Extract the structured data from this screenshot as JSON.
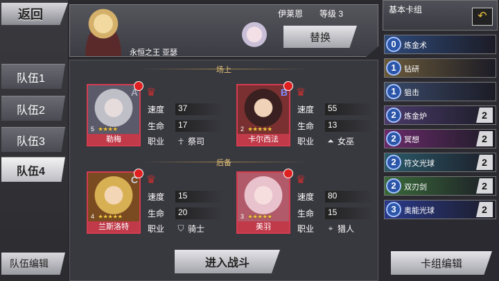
{
  "nav": {
    "back_label": "返回",
    "team_edit_label": "队伍编辑"
  },
  "teams": [
    {
      "label": "队伍1",
      "active": false
    },
    {
      "label": "队伍2",
      "active": false
    },
    {
      "label": "队伍3",
      "active": false
    },
    {
      "label": "队伍4",
      "active": true
    }
  ],
  "header": {
    "leader_name": "永恒之王 亚瑟",
    "user_name": "伊莱恩",
    "level_label": "等级 3",
    "replace_label": "替换"
  },
  "sections": {
    "field_label": "场上",
    "reserve_label": "后备"
  },
  "stat_labels": {
    "speed": "速度",
    "hp": "生命",
    "job": "职业"
  },
  "field": [
    {
      "name": "勒梅",
      "number": "5",
      "grade": "A",
      "speed": "37",
      "hp": "17",
      "job": "祭司",
      "job_icon": "ankh-icon",
      "stars": "★★★★",
      "art": "#cfcfd6"
    },
    {
      "name": "卡尔西法",
      "number": "2",
      "grade": "B",
      "speed": "55",
      "hp": "13",
      "job": "女巫",
      "job_icon": "witch-hat-icon",
      "stars": "★★★★★",
      "art": "#4a2e2e"
    }
  ],
  "reserve": [
    {
      "name": "兰斯洛特",
      "number": "4",
      "grade": "C",
      "speed": "15",
      "hp": "20",
      "job": "骑士",
      "job_icon": "shield-icon",
      "stars": "★★★★★",
      "art": "#d9b25a"
    },
    {
      "name": "美羽",
      "number": "3",
      "grade": "",
      "speed": "80",
      "hp": "15",
      "job": "猎人",
      "job_icon": "crosshair-icon",
      "stars": "★★★★★",
      "art": "#f0c8cc"
    }
  ],
  "enter_battle_label": "进入战斗",
  "deck": {
    "title": "基本卡组",
    "undo_icon": "return-arrow-icon",
    "edit_label": "卡组编辑",
    "cards": [
      {
        "cost": "0",
        "name": "炼金术",
        "count": ""
      },
      {
        "cost": "1",
        "name": "钻研",
        "count": ""
      },
      {
        "cost": "1",
        "name": "狙击",
        "count": ""
      },
      {
        "cost": "2",
        "name": "炼金炉",
        "count": "2"
      },
      {
        "cost": "2",
        "name": "冥想",
        "count": "2"
      },
      {
        "cost": "2",
        "name": "符文光球",
        "count": "2"
      },
      {
        "cost": "2",
        "name": "双刃剑",
        "count": "2"
      },
      {
        "cost": "3",
        "name": "奥能光球",
        "count": "2"
      }
    ]
  }
}
